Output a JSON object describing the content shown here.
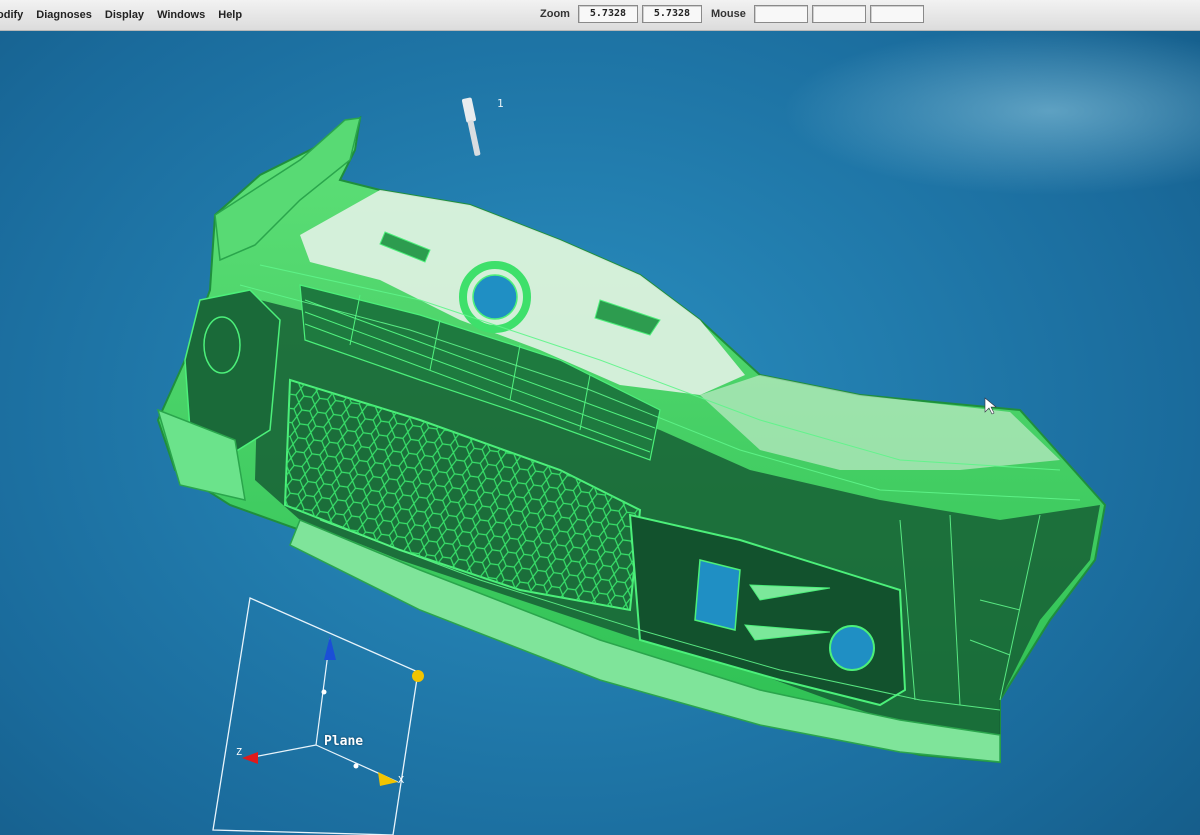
{
  "menu": {
    "items": [
      "odify",
      "Diagnoses",
      "Display",
      "Windows",
      "Help"
    ]
  },
  "status": {
    "zoom_label": "Zoom",
    "zoom_value_1": "5.7328",
    "zoom_value_2": "5.7328",
    "mouse_label": "Mouse",
    "mouse_values": [
      "",
      "",
      ""
    ]
  },
  "viewport": {
    "background_color": "#1f7fb4",
    "model_color": "#2bd35f",
    "model_highlight_color": "#e9f5ea",
    "model_label": "1",
    "plane_label": "Plane",
    "axis_z_label": "Z",
    "axis_x_label": "X"
  }
}
